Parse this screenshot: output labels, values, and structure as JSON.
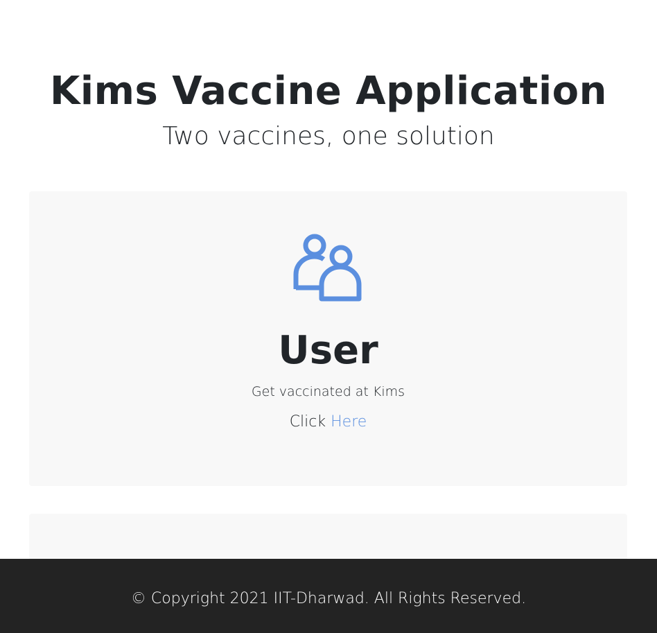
{
  "hero": {
    "title": "Kims Vaccine Application",
    "subtitle": "Two vaccines, one solution"
  },
  "user_card": {
    "icon": "users-icon",
    "icon_color": "#5b8fdf",
    "title": "User",
    "description": "Get vaccinated at Kims",
    "cta_prefix": "Click",
    "cta_link": "Here"
  },
  "footer": {
    "copyright": "© Copyright 2021 IIT-Dharwad. All Rights Reserved."
  },
  "colors": {
    "background": "#ffffff",
    "card_background": "#f8f8f8",
    "footer_background": "#232323",
    "link": "#5b8fdf",
    "text": "#212529"
  }
}
